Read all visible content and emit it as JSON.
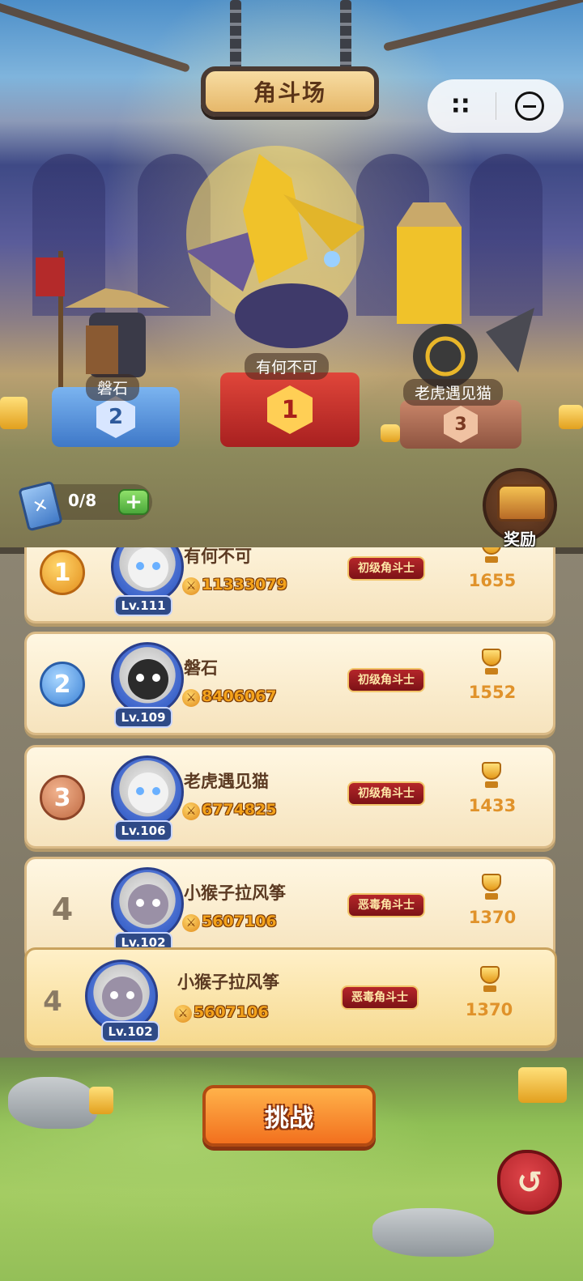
{
  "header": {
    "title": "角斗场"
  },
  "capsule": {
    "more_icon": "more-dots-icon",
    "close_icon": "minimize-circle-icon"
  },
  "podium": [
    {
      "rank": "2",
      "name": "磐石"
    },
    {
      "rank": "1",
      "name": "有何不可"
    },
    {
      "rank": "3",
      "name": "老虎遇见猫"
    }
  ],
  "tickets": {
    "count": "0/8",
    "add_label": "+"
  },
  "reward": {
    "label": "奖励"
  },
  "leaderboard": [
    {
      "rank": "1",
      "name": "有何不可",
      "level": "Lv.111",
      "power": "11333079",
      "title": "初级角斗士",
      "trophies": "1655"
    },
    {
      "rank": "2",
      "name": "磐石",
      "level": "Lv.109",
      "power": "8406067",
      "title": "初级角斗士",
      "trophies": "1552"
    },
    {
      "rank": "3",
      "name": "老虎遇见猫",
      "level": "Lv.106",
      "power": "6774825",
      "title": "初级角斗士",
      "trophies": "1433"
    },
    {
      "rank": "4",
      "name": "小猴子拉风筝",
      "level": "Lv.102",
      "power": "5607106",
      "title": "恶毒角斗士",
      "trophies": "1370"
    }
  ],
  "my_rank": {
    "rank": "4",
    "name": "小猴子拉风筝",
    "level": "Lv.102",
    "power": "5607106",
    "title": "恶毒角斗士",
    "trophies": "1370"
  },
  "actions": {
    "challenge_label": "挑战",
    "back_icon": "return-arrow-icon"
  }
}
